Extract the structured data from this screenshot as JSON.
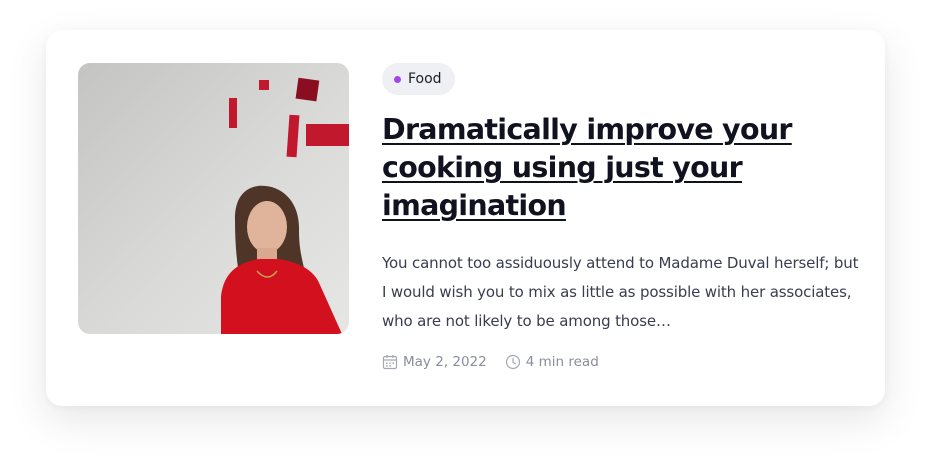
{
  "post": {
    "tag": {
      "label": "Food",
      "dot_color": "#a348e8"
    },
    "title": "Dramatically improve your cooking using just your imagination",
    "excerpt": "You cannot too assiduously attend to Madame Duval herself; but I would wish you to mix as little as possible with her associates, who are not likely to be among those…",
    "meta": {
      "date": "May 2, 2022",
      "read_time": "4 min read",
      "date_icon": "calendar-icon",
      "time_icon": "clock-icon"
    }
  }
}
